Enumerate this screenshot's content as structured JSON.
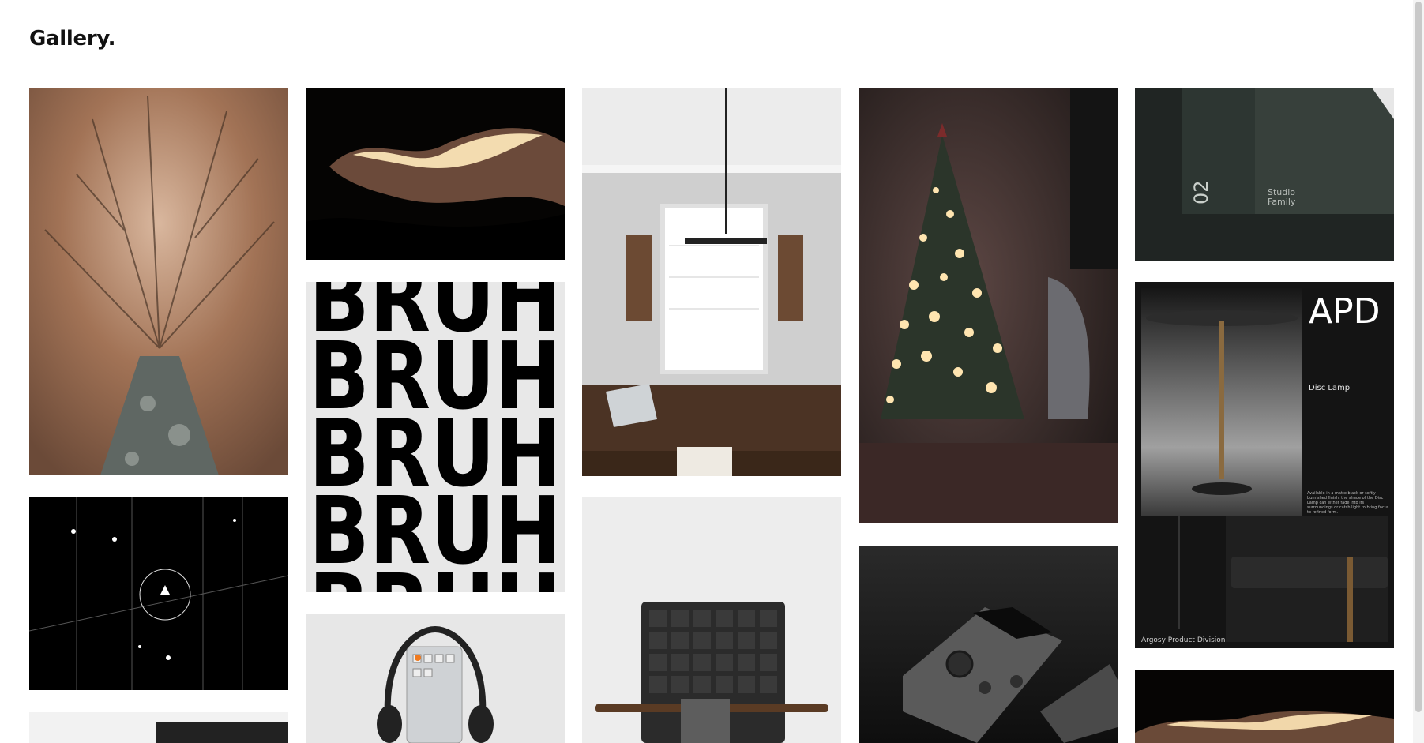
{
  "page": {
    "title": "Gallery."
  },
  "tiles": {
    "bruh": {
      "word": "BRUH"
    },
    "portfolio": {
      "number": "02",
      "label": "Studio\nFamily"
    },
    "apd": {
      "brand": "APD",
      "product": "Disc Lamp",
      "description": "Available in a matte black or softly burnished finish, the shade of the Disc Lamp can either fade into its surroundings or catch light to bring focus to refined form.",
      "footer": "Argosy Product Division"
    }
  },
  "colors": {
    "background": "#ffffff",
    "title": "#111111"
  }
}
